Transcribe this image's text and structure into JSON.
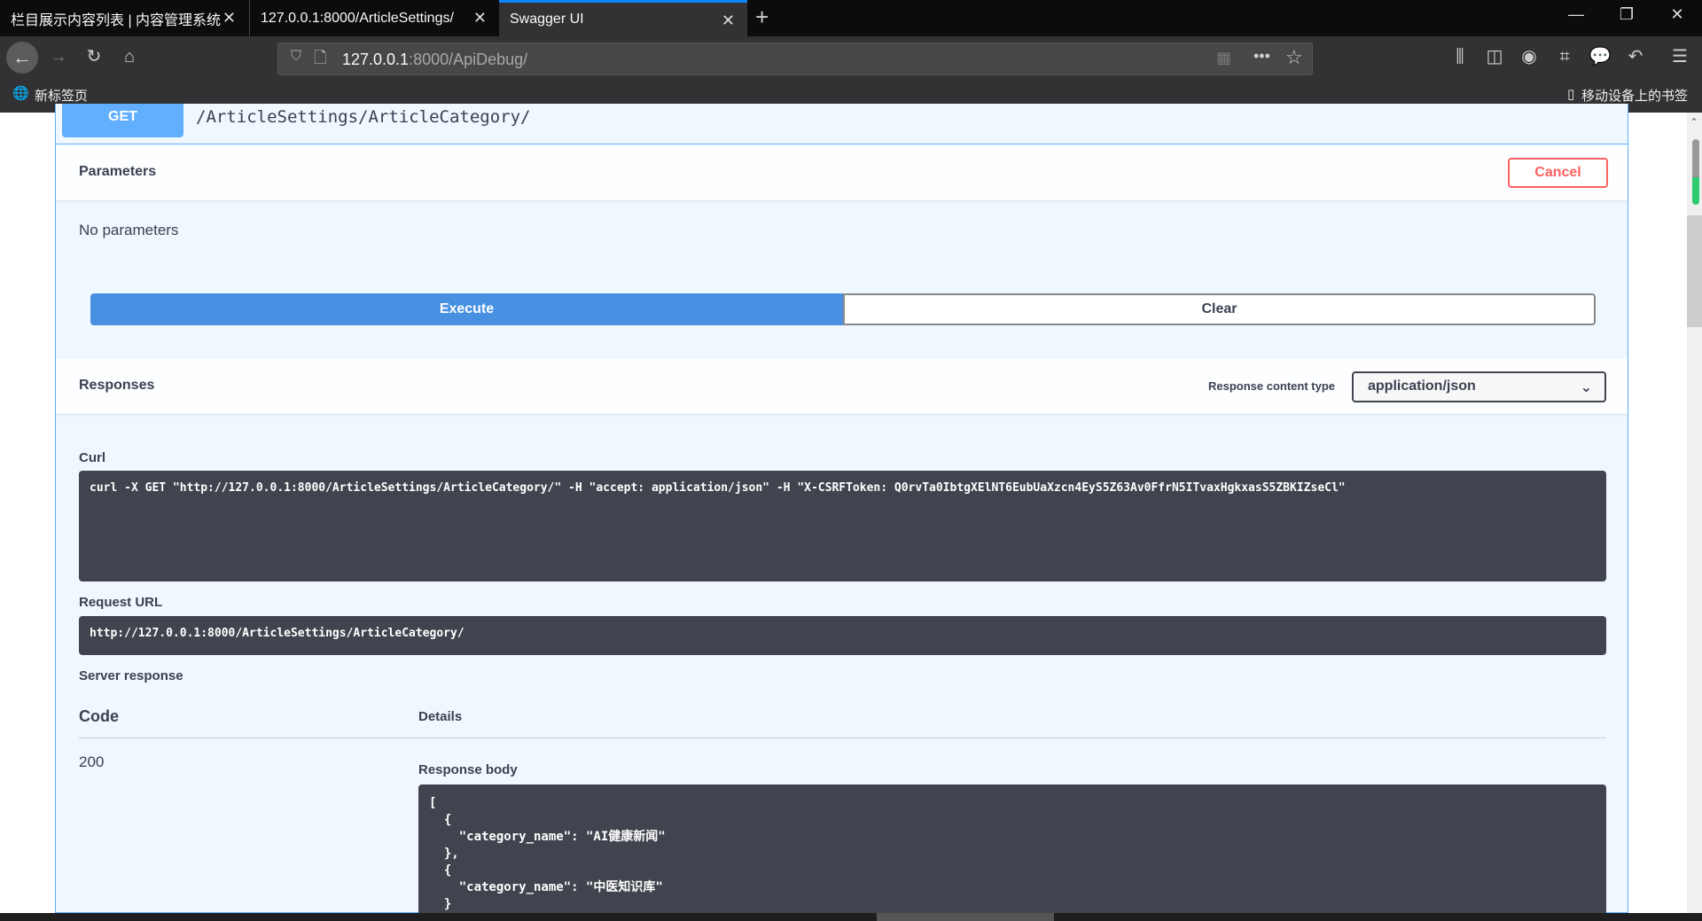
{
  "browser": {
    "tabs": [
      {
        "title": "栏目展示内容列表 | 内容管理系统"
      },
      {
        "title": "127.0.0.1:8000/ArticleSettings/"
      },
      {
        "title": "Swagger UI",
        "active": true
      }
    ],
    "url_host": "127.0.0.1",
    "url_rest": ":8000/ApiDebug/",
    "bookmark_left": "新标签页",
    "bookmark_right": "移动设备上的书签"
  },
  "operation": {
    "method": "GET",
    "path": "/ArticleSettings/ArticleCategory/"
  },
  "parameters": {
    "title": "Parameters",
    "cancel": "Cancel",
    "empty": "No parameters",
    "execute": "Execute",
    "clear": "Clear"
  },
  "responses": {
    "title": "Responses",
    "content_type_label": "Response content type",
    "content_type": "application/json",
    "curl_label": "Curl",
    "curl": "curl -X GET \"http://127.0.0.1:8000/ArticleSettings/ArticleCategory/\" -H \"accept: application/json\" -H \"X-CSRFToken: Q0rvTa0IbtgXElNT6EubUaXzcn4EyS5Z63Av0FfrN5ITvaxHgkxasS5ZBKIZseCl\"",
    "request_url_label": "Request URL",
    "request_url": "http://127.0.0.1:8000/ArticleSettings/ArticleCategory/",
    "server_response_label": "Server response",
    "code_header": "Code",
    "details_header": "Details",
    "code": "200",
    "body_label": "Response body",
    "body": "[\n  {\n    \"category_name\": \"AI健康新闻\"\n  },\n  {\n    \"category_name\": \"中医知识库\"\n  }"
  }
}
